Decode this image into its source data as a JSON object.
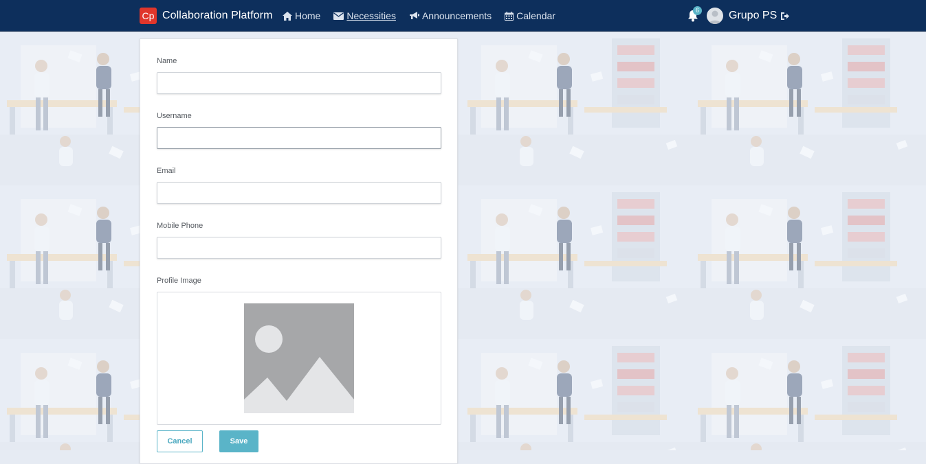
{
  "navbar": {
    "brand_logo": "Cp",
    "brand_name": "Collaboration Platform",
    "links": [
      {
        "label": "Home",
        "icon": "home-icon"
      },
      {
        "label": "Necessities",
        "icon": "envelope-icon",
        "active": true
      },
      {
        "label": "Announcements",
        "icon": "bullhorn-icon"
      },
      {
        "label": "Calendar",
        "icon": "calendar-icon"
      }
    ],
    "notifications_count": "6",
    "user_name": "Grupo PS"
  },
  "form": {
    "name": {
      "label": "Name",
      "value": ""
    },
    "username": {
      "label": "Username",
      "value": ""
    },
    "email": {
      "label": "Email",
      "value": ""
    },
    "mobile_phone": {
      "label": "Mobile Phone",
      "value": ""
    },
    "profile_image": {
      "label": "Profile Image"
    },
    "cancel_label": "Cancel",
    "save_label": "Save"
  },
  "colors": {
    "navbar_bg": "#0d2f5c",
    "brand_logo_bg": "#e0362b",
    "accent": "#5ab4c8"
  }
}
